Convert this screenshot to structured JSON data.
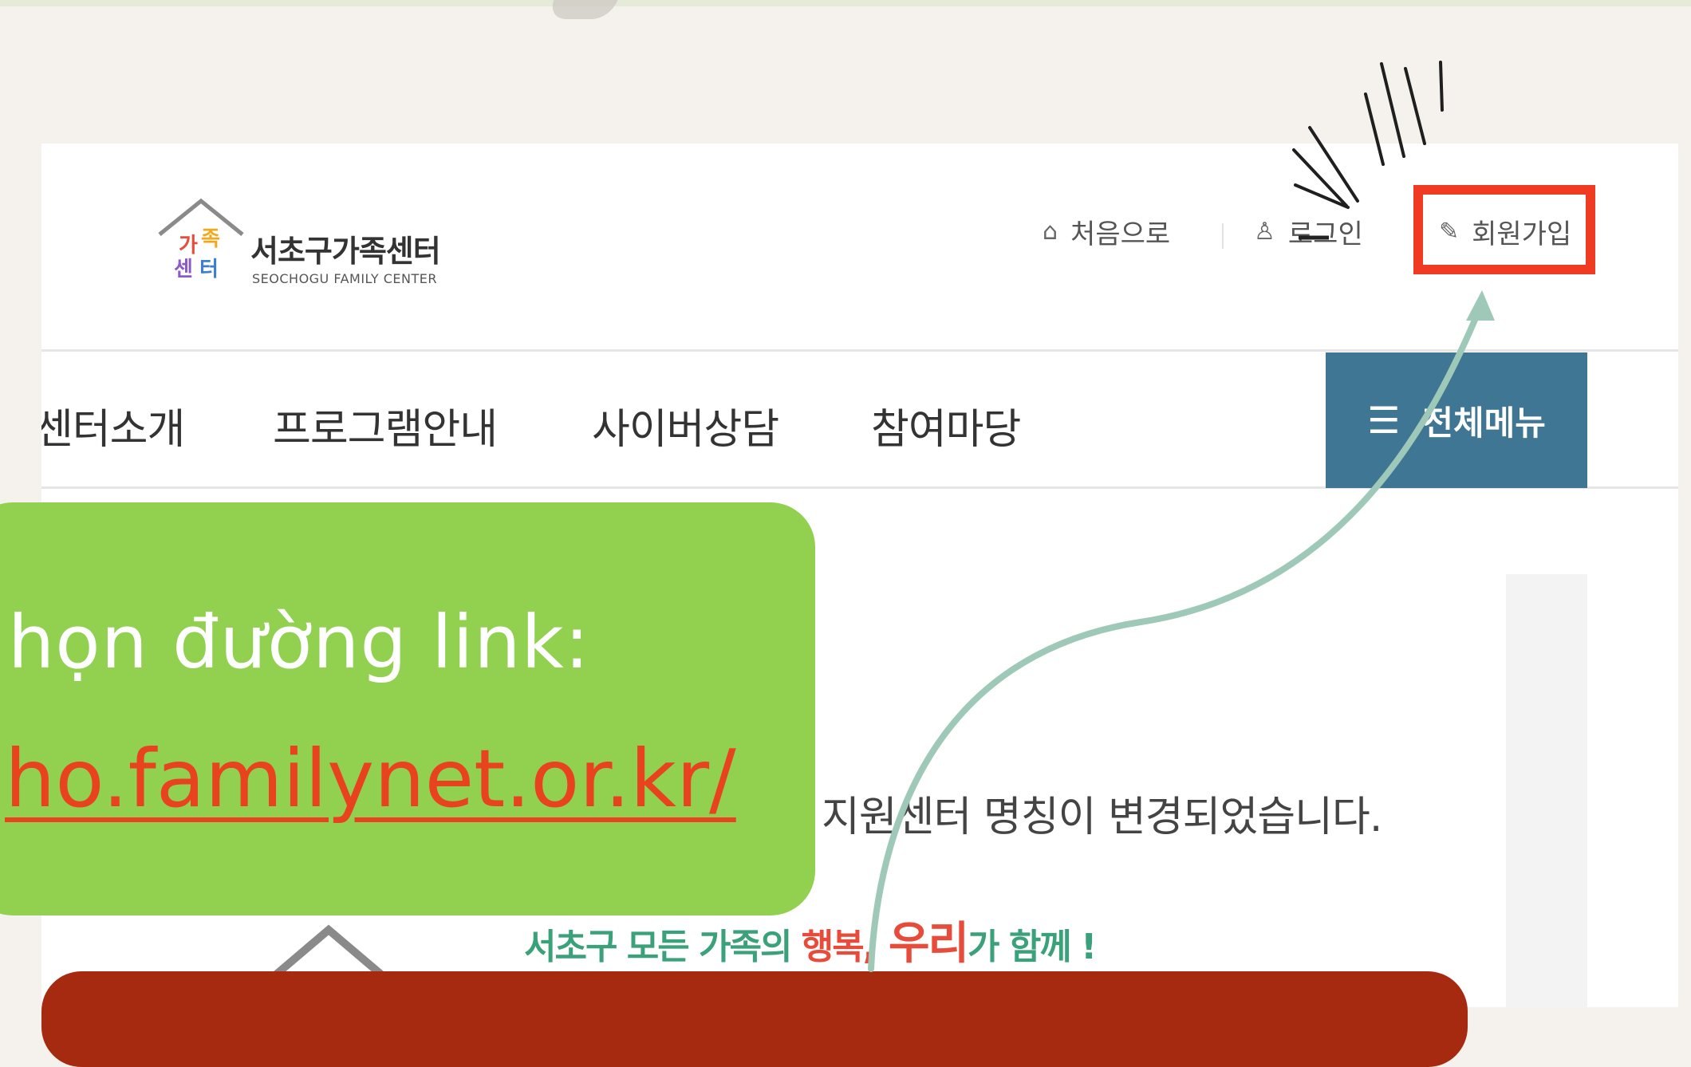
{
  "site": {
    "logo_mark": "가족센터",
    "name": "서초구가족센터",
    "subtitle": "SEOCHOGU FAMILY CENTER"
  },
  "utility_links": {
    "home": "처음으로",
    "login": "로그인",
    "signup": "회원가입"
  },
  "nav": {
    "items": [
      "센터소개",
      "프로그램안내",
      "사이버상담",
      "참여마당"
    ],
    "all_menu": "전체메뉴"
  },
  "content": {
    "notice": "지원센터 명칭이 변경되었습니다.",
    "slogan_part1": "서초구 모든 가족의 ",
    "slogan_happy": "행복,",
    "slogan_we": " 우리",
    "slogan_part2": "가 함께 !"
  },
  "callout": {
    "line1": "họn đường link:",
    "line2": "ho.familynet.or.kr/"
  },
  "colors": {
    "highlight_box": "#ee3b22",
    "green_callout": "#92d050",
    "link_text": "#e8421f",
    "menu_button": "#3e7693",
    "arrow": "#9ec9b9",
    "bottom_bar": "#a52a10"
  },
  "icons": {
    "home": "home-icon",
    "login": "user-icon",
    "signup": "edit-icon",
    "menu": "hamburger-icon"
  }
}
